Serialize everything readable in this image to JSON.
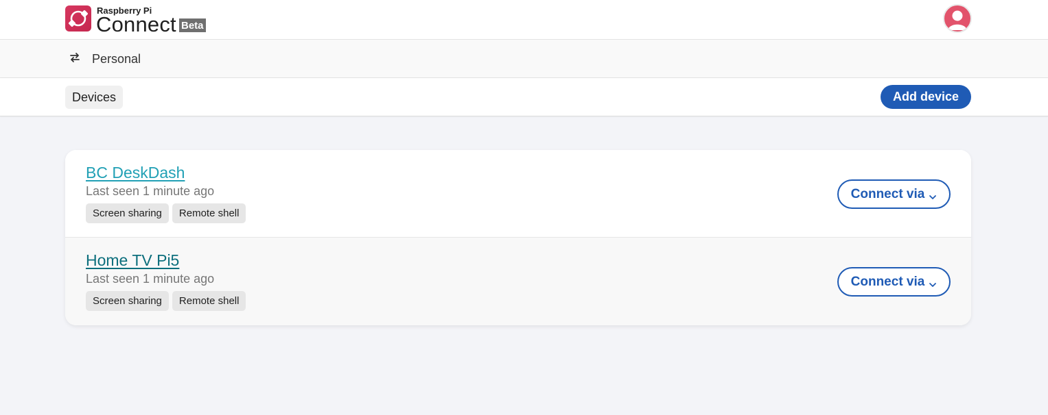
{
  "brand": {
    "small": "Raspberry Pi",
    "big": "Connect",
    "badge": "Beta",
    "accent": "#d6375f"
  },
  "header": {
    "avatar_icon": "user-avatar-icon"
  },
  "account": {
    "switch_icon": "swap-arrows-icon",
    "name": "Personal"
  },
  "nav": {
    "tabs": [
      {
        "label": "Devices",
        "selected": true
      }
    ],
    "add_device_label": "Add device",
    "primary_color": "#1f5bb5"
  },
  "devices": [
    {
      "name": "BC DeskDash",
      "last_seen": "Last seen 1 minute ago",
      "chips": [
        "Screen sharing",
        "Remote shell"
      ],
      "connect_label": "Connect via",
      "link_color": "#21a0b5"
    },
    {
      "name": "Home TV Pi5",
      "last_seen": "Last seen 1 minute ago",
      "chips": [
        "Screen sharing",
        "Remote shell"
      ],
      "connect_label": "Connect via",
      "link_color": "#0d6f7d"
    }
  ]
}
